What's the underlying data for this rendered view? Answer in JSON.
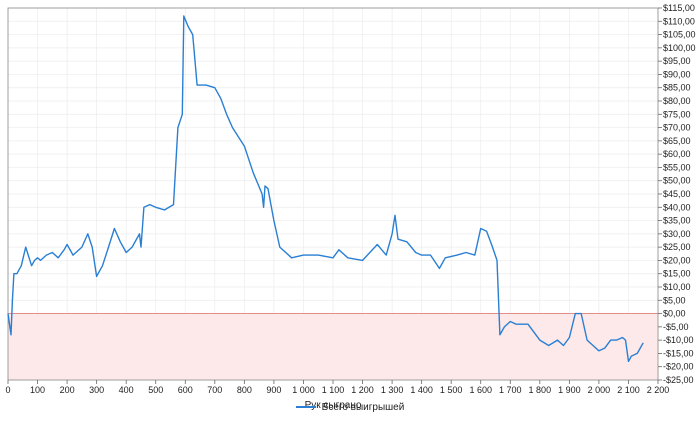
{
  "chart_data": {
    "type": "line",
    "xlabel": "Рук сыграно",
    "ylabel": "",
    "xlim": [
      0,
      2200
    ],
    "ylim": [
      -25,
      115
    ],
    "x_ticks": [
      0,
      100,
      200,
      300,
      400,
      500,
      600,
      700,
      800,
      900,
      1000,
      1100,
      1200,
      1300,
      1400,
      1500,
      1600,
      1700,
      1800,
      1900,
      2000,
      2100,
      2200
    ],
    "x_tick_labels": [
      "0",
      "100",
      "200",
      "300",
      "400",
      "500",
      "600",
      "700",
      "800",
      "900",
      "1 000",
      "1 100",
      "1 200",
      "1 300",
      "1 400",
      "1 500",
      "1 600",
      "1 700",
      "1 800",
      "1 900",
      "2 000",
      "2 100",
      "2 200"
    ],
    "y_ticks": [
      -25,
      -20,
      -15,
      -10,
      -5,
      0,
      5,
      10,
      15,
      20,
      25,
      30,
      35,
      40,
      45,
      50,
      55,
      60,
      65,
      70,
      75,
      80,
      85,
      90,
      95,
      100,
      105,
      110,
      115
    ],
    "y_tick_labels": [
      "-$25,00",
      "-$20,00",
      "-$15,00",
      "-$10,00",
      "-$5,00",
      "$0,00",
      "$5,00",
      "$10,00",
      "$15,00",
      "$20,00",
      "$25,00",
      "$30,00",
      "$35,00",
      "$40,00",
      "$45,00",
      "$50,00",
      "$55,00",
      "$60,00",
      "$65,00",
      "$70,00",
      "$75,00",
      "$80,00",
      "$85,00",
      "$90,00",
      "$95,00",
      "$100,00",
      "$105,00",
      "$110,00",
      "$115,00"
    ],
    "grid": true,
    "negative_region_shaded": true,
    "legend_position": "bottom-center",
    "series": [
      {
        "name": "Всего выигрышей",
        "color": "#2a7fd4",
        "x": [
          0,
          10,
          15,
          20,
          30,
          45,
          60,
          80,
          90,
          100,
          110,
          130,
          150,
          170,
          190,
          200,
          220,
          250,
          270,
          285,
          300,
          320,
          340,
          360,
          380,
          400,
          420,
          445,
          450,
          460,
          480,
          500,
          530,
          560,
          575,
          590,
          595,
          610,
          625,
          640,
          670,
          700,
          720,
          740,
          760,
          800,
          830,
          860,
          865,
          870,
          880,
          895,
          900,
          920,
          960,
          1000,
          1050,
          1100,
          1120,
          1150,
          1200,
          1250,
          1280,
          1300,
          1310,
          1320,
          1350,
          1380,
          1400,
          1430,
          1460,
          1480,
          1520,
          1550,
          1580,
          1600,
          1620,
          1640,
          1655,
          1665,
          1680,
          1700,
          1720,
          1760,
          1800,
          1830,
          1860,
          1880,
          1900,
          1920,
          1940,
          1960,
          1980,
          2000,
          2020,
          2040,
          2060,
          2080,
          2090,
          2100,
          2110,
          2130,
          2150
        ],
        "y": [
          0,
          -8,
          5,
          15,
          15,
          18,
          25,
          18,
          20,
          21,
          20,
          22,
          23,
          21,
          24,
          26,
          22,
          25,
          30,
          25,
          14,
          18,
          25,
          32,
          27,
          23,
          25,
          30,
          25,
          40,
          41,
          40,
          39,
          41,
          70,
          75,
          112,
          108,
          105,
          86,
          86,
          85,
          81,
          75,
          70,
          63,
          53,
          45,
          40,
          48,
          47,
          38,
          35,
          25,
          21,
          22,
          22,
          21,
          24,
          21,
          20,
          26,
          22,
          30,
          37,
          28,
          27,
          23,
          22,
          22,
          17,
          21,
          22,
          23,
          22,
          32,
          31,
          25,
          20,
          -8,
          -5,
          -3,
          -4,
          -4,
          -10,
          -12,
          -10,
          -12,
          -9,
          0,
          0,
          -10,
          -12,
          -14,
          -13,
          -10,
          -10,
          -9,
          -10,
          -18,
          -16,
          -15,
          -11
        ]
      }
    ]
  },
  "legend": {
    "label": "Всего выигрышей"
  }
}
